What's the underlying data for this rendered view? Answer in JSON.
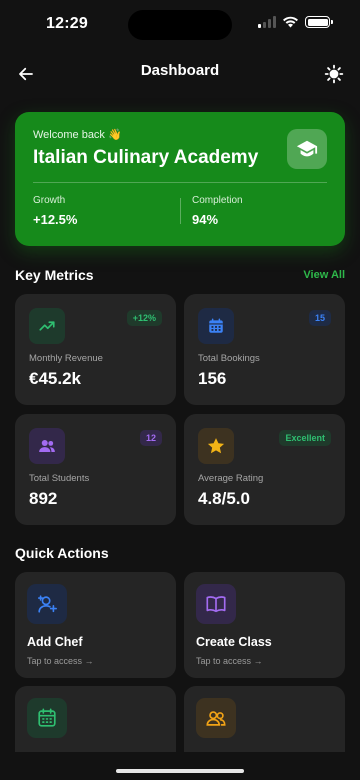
{
  "status_bar": {
    "time": "12:29"
  },
  "header": {
    "title": "Dashboard"
  },
  "hero": {
    "welcome": "Welcome back 👋",
    "title": "Italian Culinary Academy",
    "icon": "graduation-cap-icon",
    "stats": [
      {
        "label": "Growth",
        "value": "+12.5%"
      },
      {
        "label": "Completion",
        "value": "94%"
      }
    ]
  },
  "metrics_section": {
    "title": "Key Metrics",
    "view_all": "View All"
  },
  "metrics": [
    {
      "label": "Monthly Revenue",
      "value": "€45.2k",
      "badge": "+12%",
      "icon": "trending-up-icon",
      "accent": "#2fbf71",
      "badge_bg": "#1f3a2b",
      "icon_bg": "#1e3a2c"
    },
    {
      "label": "Total Bookings",
      "value": "156",
      "badge": "15",
      "icon": "calendar-icon",
      "accent": "#3b82f6",
      "badge_bg": "#1e2b45",
      "icon_bg": "#1e2a44"
    },
    {
      "label": "Total Students",
      "value": "892",
      "badge": "12",
      "icon": "users-icon",
      "accent": "#a36bf2",
      "badge_bg": "#33284a",
      "icon_bg": "#33284a"
    },
    {
      "label": "Average Rating",
      "value": "4.8/5.0",
      "badge": "Excellent",
      "icon": "star-icon",
      "accent": "#f2b316",
      "badge_bg": "#1f3a2b",
      "badge_color": "#2fbf71",
      "icon_bg": "#3d3220"
    }
  ],
  "actions_section": {
    "title": "Quick Actions"
  },
  "actions": [
    {
      "title": "Add Chef",
      "subtitle": "Tap to access →",
      "icon": "add-user-icon",
      "accent": "#3b82f6",
      "icon_bg": "#1e2a44"
    },
    {
      "title": "Create Class",
      "subtitle": "Tap to access →",
      "icon": "book-icon",
      "accent": "#a36bf2",
      "icon_bg": "#33284a"
    },
    {
      "title": "",
      "subtitle": "",
      "icon": "calendar-grid-icon",
      "accent": "#2fbf71",
      "icon_bg": "#1e3a2c"
    },
    {
      "title": "",
      "subtitle": "",
      "icon": "users-icon",
      "accent": "#f2a316",
      "icon_bg": "#3d3220"
    }
  ]
}
